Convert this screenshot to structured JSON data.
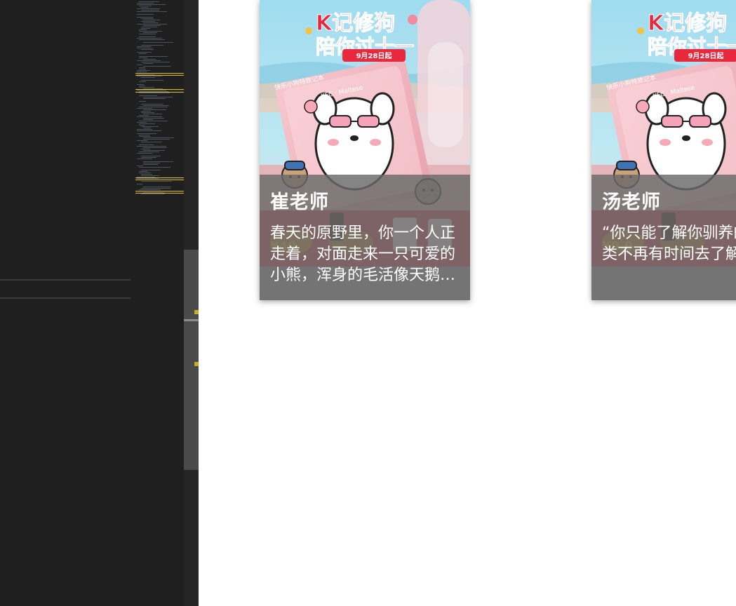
{
  "cards": [
    {
      "poster_headline": "K记修狗",
      "poster_subline": "陪你过十一",
      "poster_date": "9月28日起",
      "poster_caption": "快乐小狗特旅记本",
      "poster_brand": "KFC · Maltese",
      "name": "崔老师",
      "text": "春天的原野里，你一个人正走着，对面走来一只可爱的小熊，浑身的毛活像天鹅绒，眼睛圆鼓鼓的。"
    },
    {
      "poster_headline": "K记修狗",
      "poster_subline": "陪你过十一",
      "poster_date": "9月28日起",
      "poster_caption": "快乐小狗特旅记本",
      "poster_brand": "KFC · Maltese",
      "name": "汤老师",
      "text": "“你只能了解你驯养的东西。”狐狸说，“人类不再有时间去了解事情了，"
    }
  ],
  "colors": {
    "editor_bg": "#1f1f1f",
    "minimap_highlight": "#d7b640",
    "poster_red": "#e8283c",
    "poster_pink": "#f4b6c0",
    "overlay": "#696969"
  }
}
